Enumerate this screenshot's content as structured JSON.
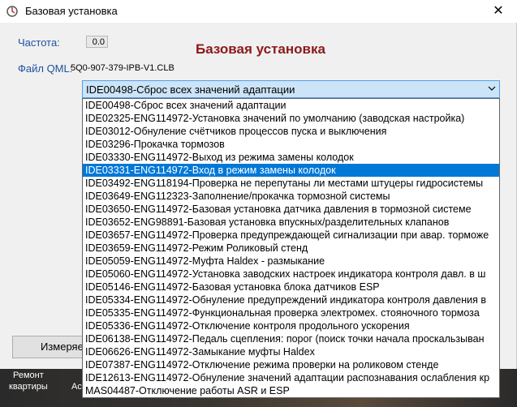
{
  "window": {
    "title": "Базовая установка",
    "close_label": "✕"
  },
  "form": {
    "frequency_label": "Частота:",
    "frequency_value": "0.0",
    "heading": "Базовая установка",
    "file_label": "Файл QML:",
    "file_value": "5Q0-907-379-IPB-V1.CLB"
  },
  "select": {
    "selected": "IDE00498-Сброс всех значений адаптации",
    "options": [
      "IDE00498-Сброс всех значений адаптации",
      "IDE02325-ENG114972-Установка значений по умолчанию (заводская настройка)",
      "IDE03012-Обнуление счётчиков процессов пуска и выключения",
      "IDE03296-Прокачка тормозов",
      "IDE03330-ENG114972-Выход из режима замены колодок",
      "IDE03331-ENG114972-Вход в режим замены колодок",
      "IDE03492-ENG118194-Проверка не перепутаны ли местами штуцеры гидросистемы",
      "IDE03649-ENG112323-Заполнение/прокачка тормозной системы",
      "IDE03650-ENG114972-Базовая установка датчика давления в тормозной системе",
      "IDE03652-ENG98891-Базовая установка впускных/разделительных клапанов",
      "IDE03657-ENG114972-Проверка предупреждающей сигнализации при авар. торможе",
      "IDE03659-ENG114972-Режим Роликовый стенд",
      "IDE05059-ENG114972-Муфта Haldex - размыкание",
      "IDE05060-ENG114972-Установка заводских настроек индикатора контроля давл. в ш",
      "IDE05146-ENG114972-Базовая установка блока датчиков ESP",
      "IDE05334-ENG114972-Обнуление предупреждений индикатора контроля давления в",
      "IDE05335-ENG114972-Функциональная проверка электромех. стояночного тормоза",
      "IDE05336-ENG114972-Отключение контроля продольного ускорения",
      "IDE06138-ENG114972-Педаль сцепления: порог (поиск точки начала проскальзыван",
      "IDE06626-ENG114972-Замыкание муфты Haldex",
      "IDE07387-ENG114972-Отключение режима проверки на роликовом стенде",
      "IDE12613-ENG114972-Обнуление значений адаптации распознавания ослабления кр",
      "MAS04487-Отключение работы ASR и ESP"
    ],
    "highlighted_index": 5
  },
  "buttons": {
    "measure_label": "Измеряе"
  },
  "background": {
    "text_1": "Ремонт",
    "text_2": "квартиры",
    "text_3": "Ac"
  },
  "colors": {
    "accent": "#0078d7",
    "heading": "#8b1a1a",
    "label": "#2050a0"
  }
}
